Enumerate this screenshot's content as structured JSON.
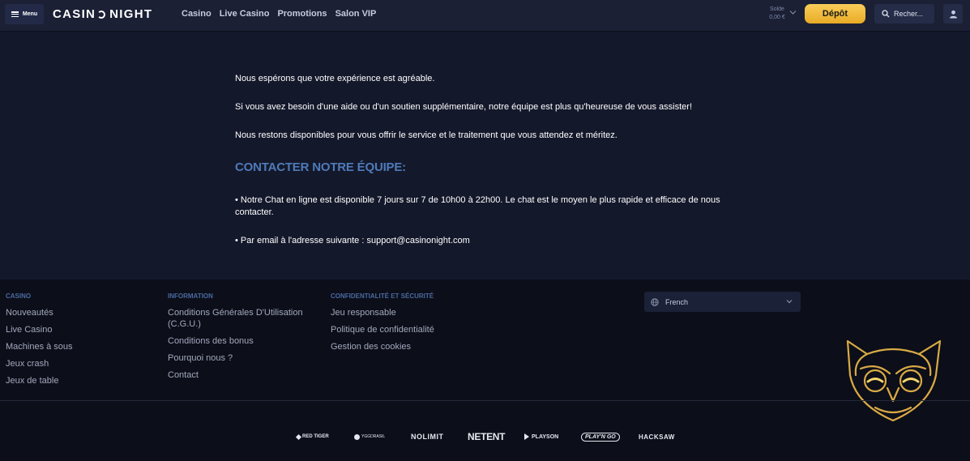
{
  "header": {
    "menu_label": "Menu",
    "logo_left": "CASIN",
    "logo_right": "NIGHT",
    "nav": [
      "Casino",
      "Live Casino",
      "Promotions",
      "Salon VIP"
    ],
    "balance_label": "Solde",
    "balance_amount": "0,00 €",
    "deposit_label": "Dépôt",
    "search_placeholder": "Recher..."
  },
  "main": {
    "paragraphs": [
      "Nous espérons que votre expérience est agréable.",
      "Si vous avez besoin d'une aide ou d'un soutien supplémentaire, notre équipe est plus qu'heureuse de vous assister!",
      "Nous restons disponibles pour vous offrir le service et le traitement que vous attendez et méritez."
    ],
    "heading": "CONTACTER NOTRE ÉQUIPE:",
    "bullets": [
      "• Notre Chat en ligne est disponible 7 jours sur 7 de 10h00 à 22h00. Le chat est le moyen le plus rapide et efficace de nous contacter.",
      "• Par email à l'adresse suivante : support@casinonight.com"
    ]
  },
  "footer": {
    "columns": [
      {
        "title": "CASINO",
        "links": [
          "Nouveautés",
          "Live Casino",
          "Machines à sous",
          "Jeux crash",
          "Jeux de table"
        ]
      },
      {
        "title": "INFORMATION",
        "links": [
          "Conditions Générales D'Utilisation (C.G.U.)",
          "Conditions des bonus",
          "Pourquoi nous ?",
          "Contact"
        ]
      },
      {
        "title": "CONFIDENTIALITÉ ET SÉCURITÉ",
        "links": [
          "Jeu responsable",
          "Politique de confidentialité",
          "Gestion des cookies"
        ]
      }
    ],
    "language": "French",
    "providers": [
      "RED TIGER",
      "YGGDRASIL",
      "NOLIMIT",
      "NETENT",
      "PLAYSON",
      "PLAY'N GO",
      "HACKSAW"
    ]
  },
  "colors": {
    "accent_gold": "#f2bb3c",
    "heading_blue": "#4e7bb8",
    "background": "#14182b",
    "footer_background": "#0c0e19"
  },
  "icons": {
    "menu": "hamburger-icon",
    "search": "search-icon",
    "account": "user-icon",
    "language": "globe-icon",
    "owl": "owl-mascot-icon"
  }
}
